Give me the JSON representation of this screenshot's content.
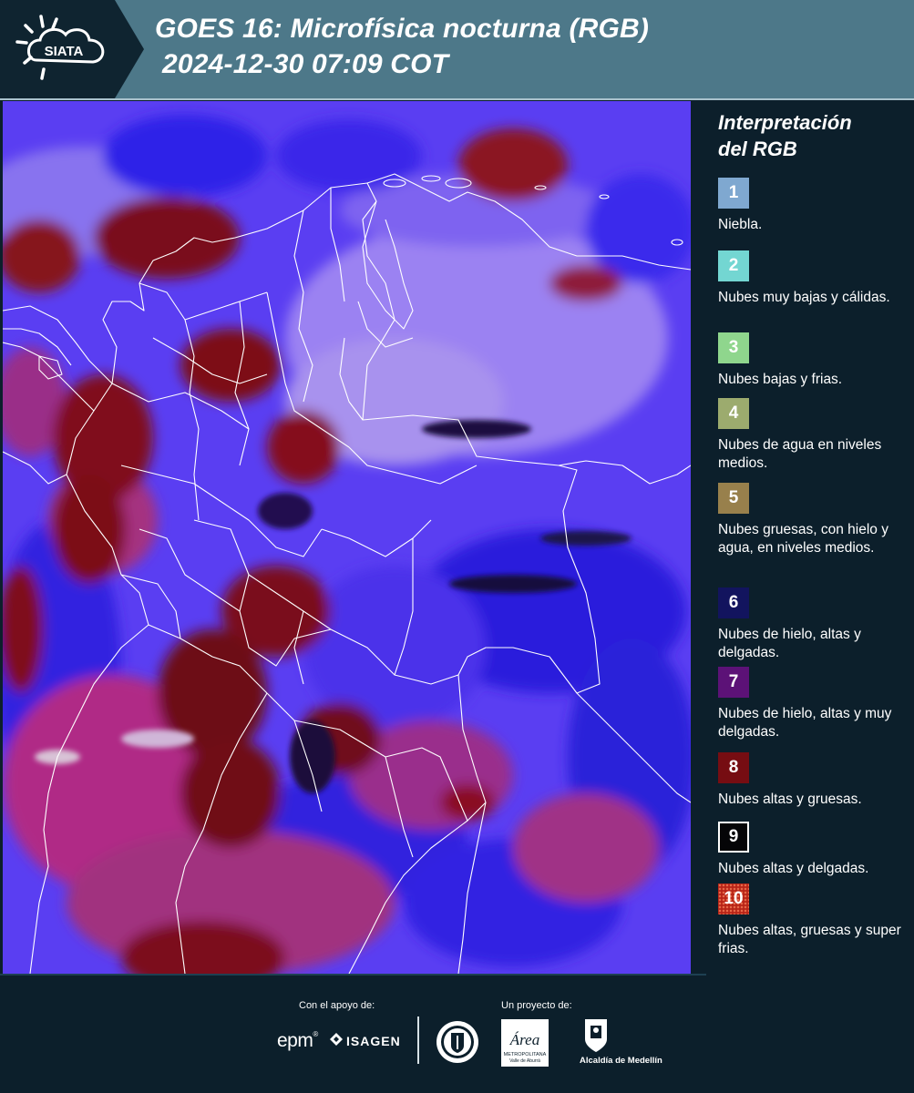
{
  "header": {
    "logo_text": "SIATA",
    "title_line1": "GOES 16: Microfísica nocturna (RGB)",
    "title_line2": "2024-12-30 07:09 COT",
    "logo_icon": "sun-cloud-icon"
  },
  "map": {
    "description_icon": "satellite-rgb-map"
  },
  "legend": {
    "title_line1": "Interpretación",
    "title_line2": "del RGB",
    "items": [
      {
        "num": "1",
        "color": "#7fa8d0",
        "text": "Niebla."
      },
      {
        "num": "2",
        "color": "#73d6d2",
        "text": "Nubes muy bajas y cálidas."
      },
      {
        "num": "3",
        "color": "#8fd68d",
        "text": "Nubes bajas y frias."
      },
      {
        "num": "4",
        "color": "#9cab6e",
        "text": "Nubes de agua en niveles medios."
      },
      {
        "num": "5",
        "color": "#98804c",
        "text": "Nubes gruesas, con hielo y agua, en niveles medios."
      },
      {
        "num": "6",
        "color": "#12145e",
        "text": "Nubes de hielo, altas y delgadas."
      },
      {
        "num": "7",
        "color": "#5c1277",
        "text": "Nubes de hielo, altas y muy delgadas."
      },
      {
        "num": "8",
        "color": "#760d12",
        "text": "Nubes altas y gruesas."
      },
      {
        "num": "9",
        "color": "#050507",
        "text": "Nubes altas y delgadas."
      },
      {
        "num": "10",
        "color": "#b82418",
        "text": "Nubes altas, gruesas y super frias."
      }
    ]
  },
  "footer": {
    "support_label": "Con el apoyo de:",
    "project_label": "Un proyecto de:",
    "epm": "epm",
    "isagen": "ISAGEN",
    "area_text": "Área",
    "area_sub1": "METROPOLITANA",
    "area_sub2": "Valle de Aburrá",
    "alcaldia": "Alcaldía de Medellín"
  }
}
